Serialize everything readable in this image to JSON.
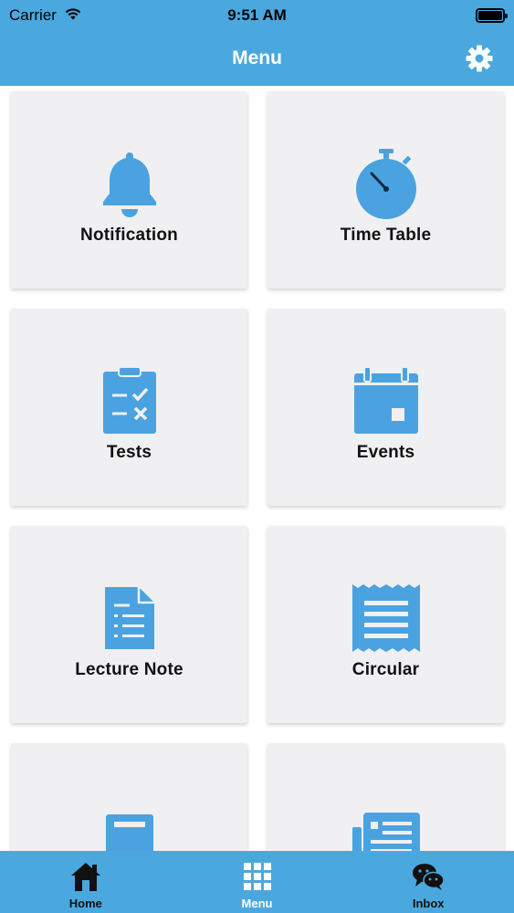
{
  "status_bar": {
    "carrier": "Carrier",
    "time": "9:51 AM"
  },
  "nav": {
    "title": "Menu",
    "settings_icon": "gear-icon"
  },
  "tiles": [
    {
      "label": "Notification",
      "icon": "bell-icon"
    },
    {
      "label": "Time Table",
      "icon": "stopwatch-icon"
    },
    {
      "label": "Tests",
      "icon": "clipboard-checklist-icon"
    },
    {
      "label": "Events",
      "icon": "calendar-icon"
    },
    {
      "label": "Lecture Note",
      "icon": "document-list-icon"
    },
    {
      "label": "Circular",
      "icon": "receipt-icon"
    },
    {
      "label": "",
      "icon": "book-icon"
    },
    {
      "label": "",
      "icon": "newspaper-icon"
    }
  ],
  "tab_bar": {
    "items": [
      {
        "label": "Home",
        "icon": "home-icon"
      },
      {
        "label": "Menu",
        "icon": "grid-icon",
        "active": true
      },
      {
        "label": "Inbox",
        "icon": "chat-bubbles-icon"
      }
    ]
  },
  "colors": {
    "accent": "#4aa8df",
    "icon_blue": "#4aa3e0",
    "tile_bg": "#f0f0f3"
  }
}
